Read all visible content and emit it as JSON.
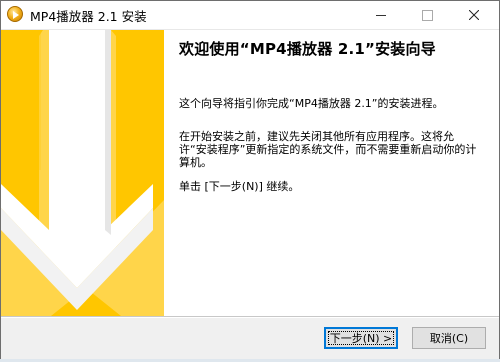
{
  "window": {
    "title": "MP4播放器 2.1 安装"
  },
  "wizard": {
    "heading": "欢迎使用“MP4播放器 2.1”安装向导",
    "paragraphs": [
      "这个向导将指引你完成“MP4播放器 2.1”的安装进程。",
      "在开始安装之前，建议先关闭其他所有应用程序。这将允许“安装程序”更新指定的系统文件，而不需要重新启动你的计算机。",
      "单击 [下一步(N)] 继续。"
    ]
  },
  "buttons": {
    "next": "下一步(N) >",
    "cancel": "取消(C)"
  },
  "colors": {
    "banner": "#ffc600",
    "arrow": "#ffffff"
  }
}
